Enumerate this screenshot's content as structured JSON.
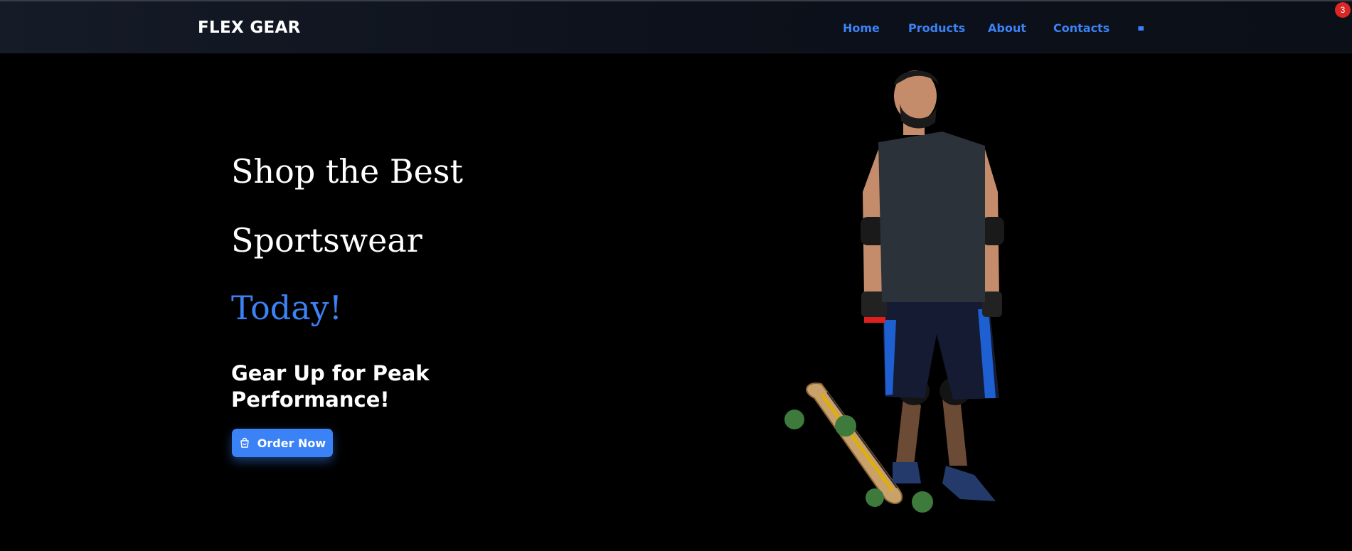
{
  "brand": "FLEX GEAR",
  "nav": {
    "items": [
      {
        "label": "Home"
      },
      {
        "label": "Products"
      },
      {
        "label": "About"
      },
      {
        "label": "Contacts"
      }
    ],
    "flag_icon": "flag-icon"
  },
  "notifications": {
    "count": "3",
    "color": "#dc2626"
  },
  "hero": {
    "line1": "Shop the Best",
    "line2": "Sportswear",
    "line3": "Today!",
    "subheading": "Gear Up for Peak Performance!",
    "cta": {
      "label": "Order Now",
      "icon": "shopping-bag-icon"
    },
    "image": "skateboarder-with-longboard"
  },
  "colors": {
    "accent": "#3b82f6",
    "background": "#000000",
    "navbar": "#0d111b",
    "text": "#ffffff"
  }
}
